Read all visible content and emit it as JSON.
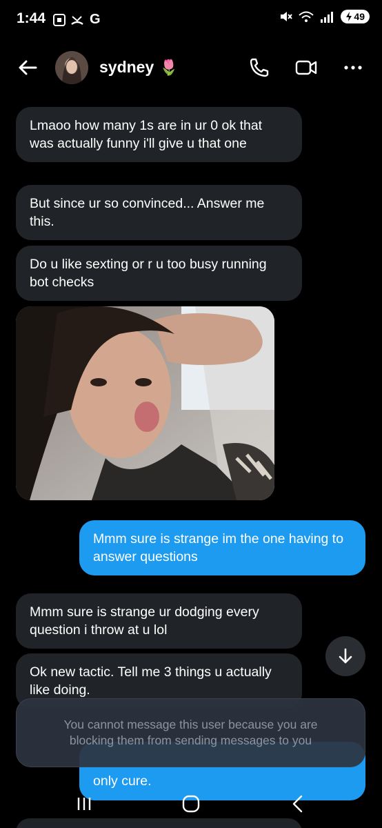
{
  "status_bar": {
    "time": "1:44",
    "carrier_letter": "G",
    "network": "5",
    "battery": "49"
  },
  "header": {
    "contact_name": "sydney",
    "contact_emoji": "🌷"
  },
  "messages": [
    {
      "direction": "in",
      "text": "Lmaoo how many 1s are in ur 0 ok that was actually funny i'll give u that one"
    },
    {
      "direction": "in",
      "text": "But since ur so convinced... Answer me this."
    },
    {
      "direction": "in",
      "text": "Do u like sexting or r u too busy running bot checks"
    },
    {
      "direction": "in",
      "type": "photo"
    },
    {
      "direction": "out",
      "text": "Mmm sure is strange im the one having to answer questions"
    },
    {
      "direction": "in",
      "text": "Mmm sure is strange ur dodging every question i throw at u lol"
    },
    {
      "direction": "in",
      "text": "Ok new tactic. Tell me 3 things u actually like doing."
    },
    {
      "direction": "out",
      "text": "only cure."
    }
  ],
  "blocked_notice": "You cannot message this user because you are blocking them from sending messages to you",
  "colors": {
    "background": "#000000",
    "incoming_bubble": "#202327",
    "outgoing_bubble": "#1d9bf0"
  }
}
